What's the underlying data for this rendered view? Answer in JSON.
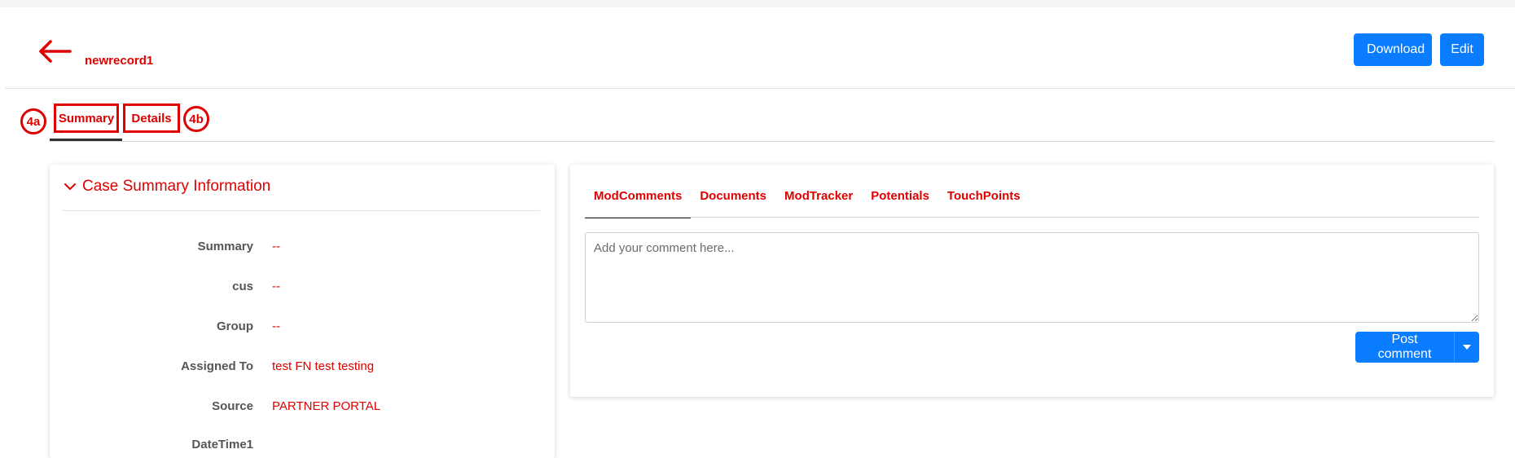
{
  "header": {
    "record_name": "newrecord1",
    "download_label": "Download",
    "edit_label": "Edit"
  },
  "annotations": {
    "summary_marker": "4a",
    "details_marker": "4b"
  },
  "main_tabs": [
    {
      "label": "Summary",
      "active": true
    },
    {
      "label": "Details",
      "active": false
    }
  ],
  "case_summary": {
    "title": "Case Summary Information",
    "fields": [
      {
        "label": "Summary",
        "value": "--"
      },
      {
        "label": "cus",
        "value": "--"
      },
      {
        "label": "Group",
        "value": "--"
      },
      {
        "label": "Assigned To",
        "value": "test FN test testing"
      },
      {
        "label": "Source",
        "value": "PARTNER PORTAL"
      },
      {
        "label": "DateTime1",
        "value": ""
      }
    ]
  },
  "related": {
    "tabs": [
      {
        "label": "ModComments",
        "active": true
      },
      {
        "label": "Documents",
        "active": false
      },
      {
        "label": "ModTracker",
        "active": false
      },
      {
        "label": "Potentials",
        "active": false
      },
      {
        "label": "TouchPoints",
        "active": false
      }
    ],
    "comment_placeholder": "Add your comment here...",
    "post_label": "Post comment"
  },
  "colors": {
    "accent_red": "#e00000",
    "primary_blue": "#0a7cff"
  },
  "icons": {
    "back": "arrow-left-icon",
    "collapse": "chevron-down-icon",
    "dropdown": "caret-down-icon"
  }
}
